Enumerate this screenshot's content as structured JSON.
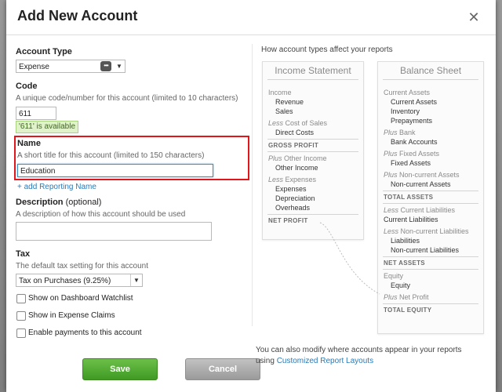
{
  "modal": {
    "title": "Add New Account"
  },
  "account_type": {
    "label": "Account Type",
    "value": "Expense",
    "more": "•••"
  },
  "code": {
    "label": "Code",
    "hint": "A unique code/number for this account (limited to 10 characters)",
    "value": "611",
    "available": "'611' is available"
  },
  "name": {
    "label": "Name",
    "hint": "A short title for this account (limited to 150 characters)",
    "value": "Education",
    "add_reporting_link": "+ add Reporting Name"
  },
  "description": {
    "label": "Description",
    "label_optional": " (optional)",
    "hint": "A description of how this account should be used",
    "value": ""
  },
  "tax": {
    "label": "Tax",
    "hint": "The default tax setting for this account",
    "value": "Tax on Purchases (9.25%)"
  },
  "checkboxes": [
    {
      "label": "Show on Dashboard Watchlist",
      "checked": false
    },
    {
      "label": "Show in Expense Claims",
      "checked": false
    },
    {
      "label": "Enable payments to this account",
      "checked": false
    }
  ],
  "buttons": {
    "save": "Save",
    "cancel": "Cancel"
  },
  "preview": {
    "title": "How account types affect your reports",
    "income_statement": {
      "heading": "Income Statement",
      "lines": {
        "income": "Income",
        "revenue": "Revenue",
        "sales": "Sales",
        "less_cost_prefix": "Less",
        "less_cost": " Cost of Sales",
        "direct_costs": "Direct Costs",
        "gross_profit": "GROSS PROFIT",
        "plus_other_prefix": "Plus",
        "plus_other": " Other Income",
        "other_income": "Other Income",
        "less_exp_prefix": "Less",
        "less_exp": " Expenses",
        "expenses": "Expenses",
        "depreciation": "Depreciation",
        "overheads": "Overheads",
        "net_profit": "NET PROFIT"
      }
    },
    "balance_sheet": {
      "heading": "Balance Sheet",
      "lines": {
        "current_assets_group": "Current Assets",
        "current_assets": "Current Assets",
        "inventory": "Inventory",
        "prepayments": "Prepayments",
        "plus_bank_prefix": "Plus",
        "plus_bank": " Bank",
        "bank_accounts": "Bank Accounts",
        "plus_fixed_prefix": "Plus",
        "plus_fixed": " Fixed Assets",
        "fixed_assets": "Fixed Assets",
        "plus_noncur_prefix": "Plus",
        "plus_noncur": " Non-current Assets",
        "noncurrent_assets": "Non-current Assets",
        "total_assets": "TOTAL ASSETS",
        "less_cur_liab_prefix": "Less",
        "less_cur_liab": " Current Liabilities",
        "current_liabilities": "Current Liabilities",
        "less_noncur_liab_prefix": "Less",
        "less_noncur_liab": " Non-current Liabilities",
        "liabilities": "Liabilities",
        "noncurrent_liabilities": "Non-current Liabilities",
        "net_assets": "NET ASSETS",
        "equity_group": "Equity",
        "equity": "Equity",
        "plus_net_profit_prefix": "Plus",
        "plus_net_profit": " Net Profit",
        "total_equity": "TOTAL EQUITY"
      }
    },
    "footer": {
      "line1": "You can also modify where accounts appear in your reports",
      "line2_prefix": "using ",
      "link": "Customized Report Layouts"
    }
  }
}
